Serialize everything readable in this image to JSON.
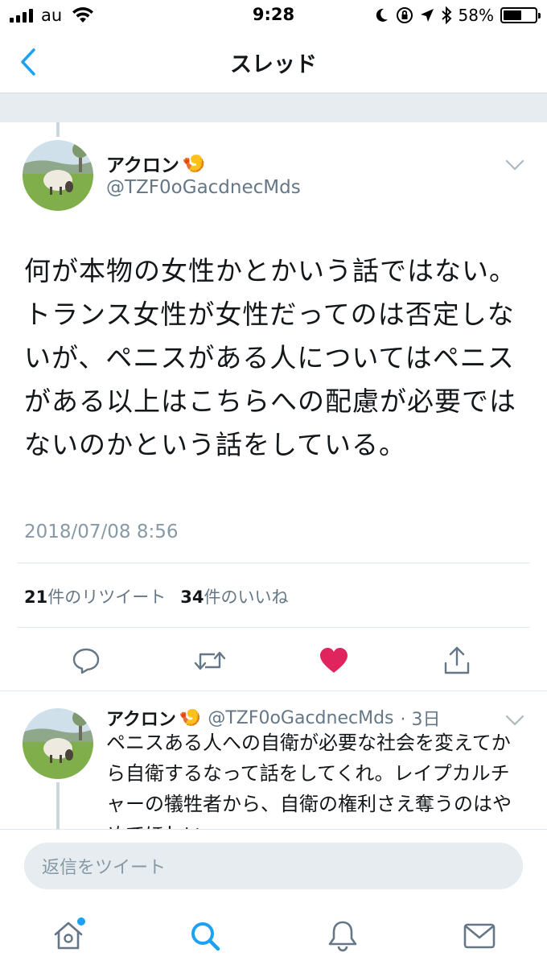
{
  "status_bar": {
    "carrier": "au",
    "time": "9:28",
    "battery_percent": "58%",
    "battery_level": 0.58,
    "icons": [
      "signal-icon",
      "wifi-icon",
      "moon-icon",
      "orientation-lock-icon",
      "location-icon",
      "bluetooth-icon",
      "battery-icon"
    ]
  },
  "nav": {
    "title": "スレッド",
    "back_icon": "chevron-left-icon"
  },
  "main_tweet": {
    "display_name": "アクロン",
    "name_emoji": "🍤",
    "handle": "@TZF0oGacdnecMds",
    "text": "何が本物の女性かとかいう話ではない。トランス女性が女性だってのは否定しないが、ペニスがある人についてはペニスがある以上はこちらへの配慮が必要ではないのかという話をしている。",
    "timestamp": "2018/07/08 8:56",
    "retweet_count": "21",
    "retweet_label": "件のリツイート",
    "like_count": "34",
    "like_label": "件のいいね",
    "liked": true,
    "colors": {
      "like_active": "#e0245e",
      "icon_gray": "#657786"
    }
  },
  "reply_tweet": {
    "display_name": "アクロン",
    "name_emoji": "🍤",
    "handle": "@TZF0oGacdnecMds",
    "age": "· 3日",
    "text": "ペニスある人への自衛が必要な社会を変えてから自衛するなって話をしてくれ。レイプカルチャーの犠牲者から、自衛の権利さえ奪うのはやめてほしい。"
  },
  "composer": {
    "placeholder": "返信をツイート"
  },
  "tab_bar": {
    "items": [
      "home-icon",
      "search-icon",
      "notifications-icon",
      "messages-icon"
    ],
    "active": "search-icon",
    "accent": "#1da1f2"
  }
}
